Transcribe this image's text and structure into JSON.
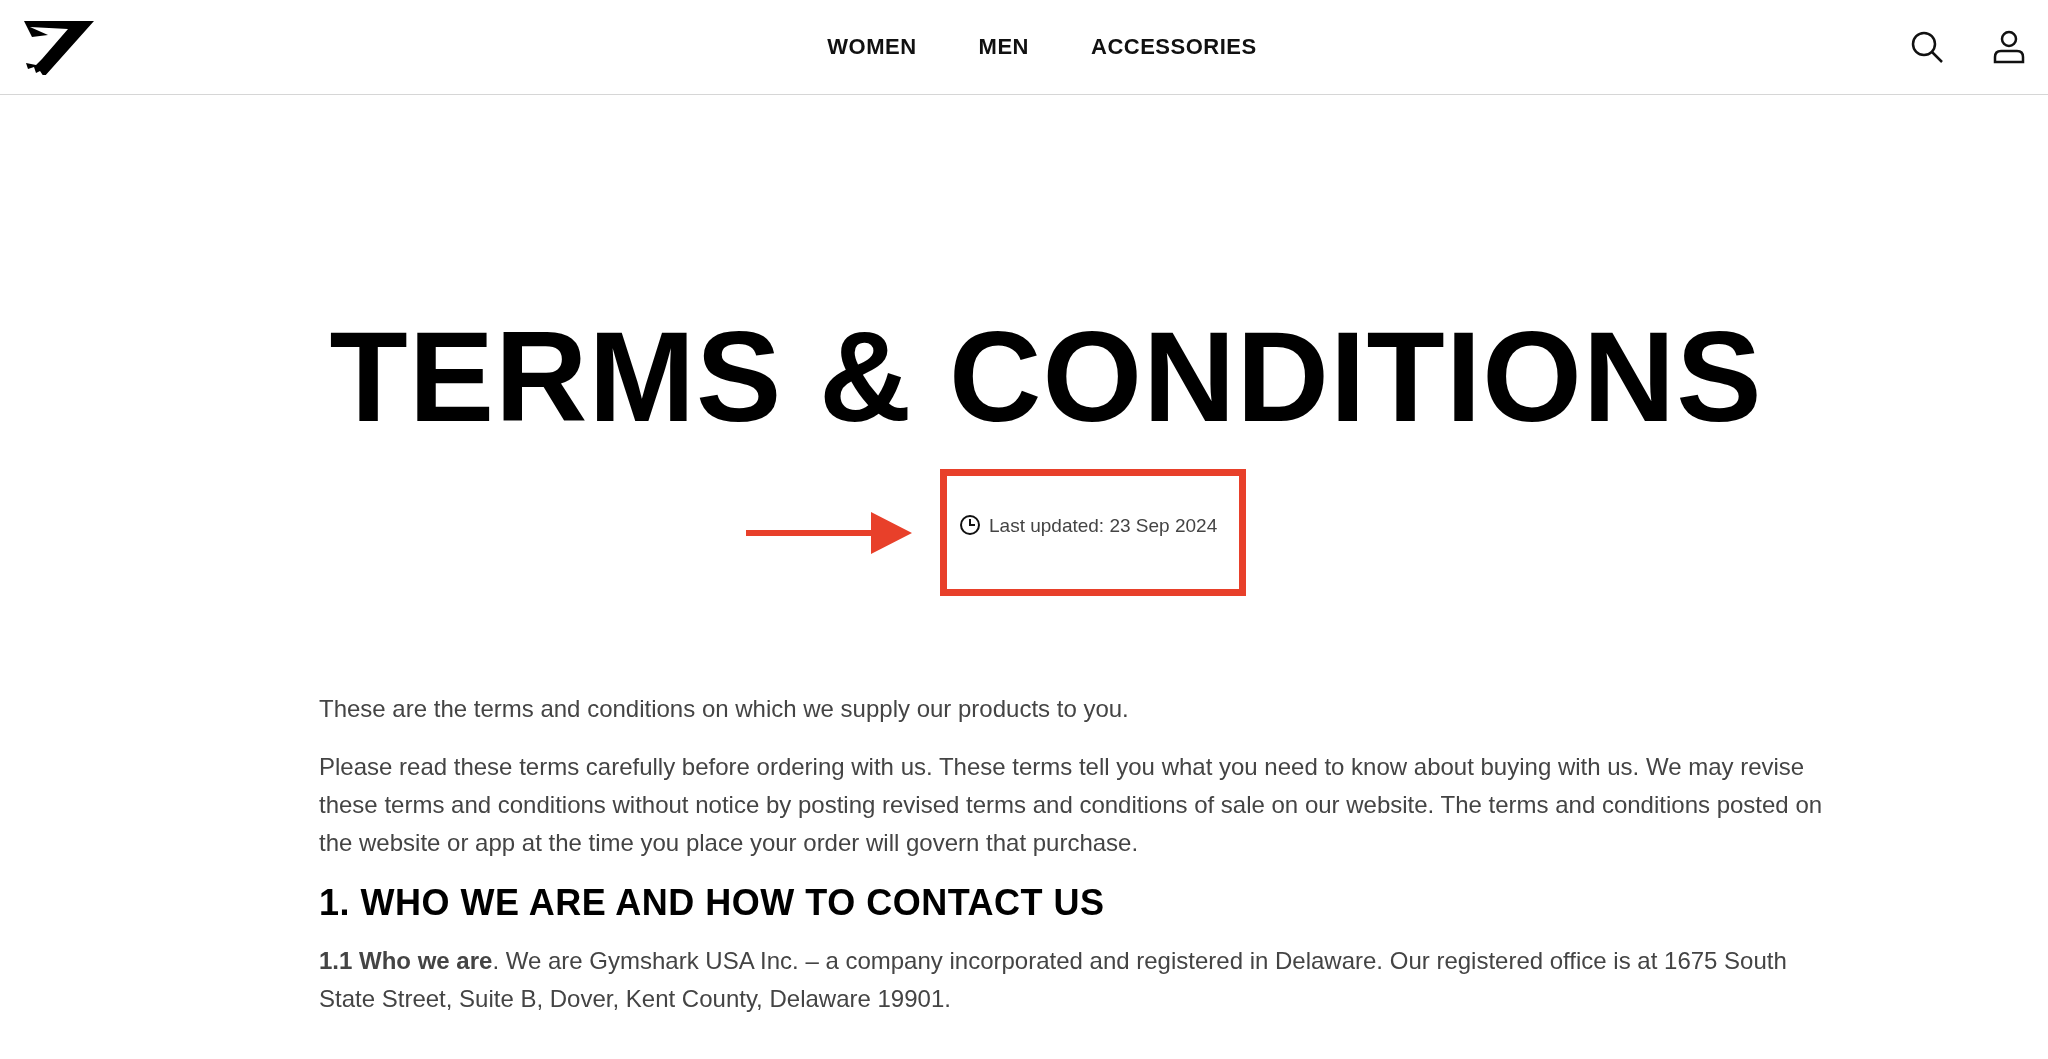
{
  "header": {
    "nav": [
      "WOMEN",
      "MEN",
      "ACCESSORIES"
    ]
  },
  "title": "TERMS & CONDITIONS",
  "last_updated": "Last updated: 23 Sep 2024",
  "body": [
    {
      "kind": "paragraph",
      "text": "These are the terms and conditions on which we supply our products to you."
    },
    {
      "kind": "paragraph",
      "text": "Please read these terms carefully before ordering with us. These terms tell you what you need to know about buying with us.  We may revise these terms and conditions without notice by posting revised terms and conditions of sale on our website.  The terms and conditions posted on the website or app at the time you place your order will govern that purchase."
    },
    {
      "kind": "heading",
      "text": "1. WHO WE ARE AND HOW TO CONTACT US"
    },
    {
      "kind": "paragraph",
      "text": "**1.1 Who we are**. We are Gymshark USA Inc. – a company incorporated and registered in Delaware. Our registered office is at 1675 South State Street, Suite B, Dover, Kent County, Delaware 19901."
    }
  ]
}
